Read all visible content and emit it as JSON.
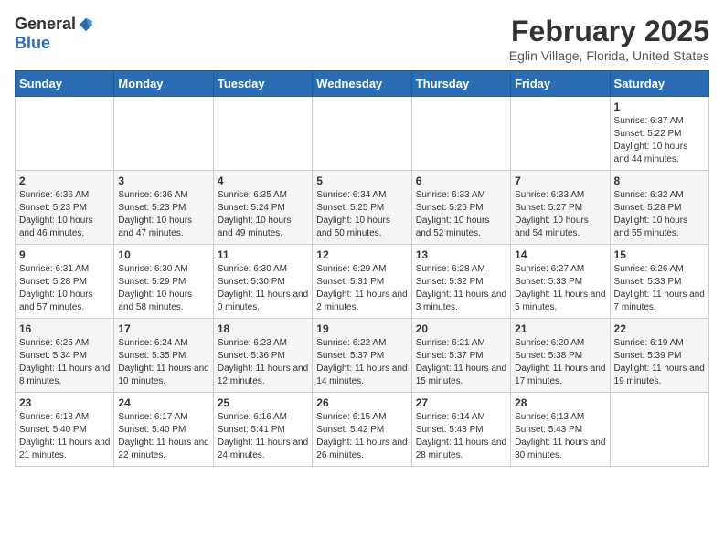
{
  "header": {
    "logo_general": "General",
    "logo_blue": "Blue",
    "month": "February 2025",
    "location": "Eglin Village, Florida, United States"
  },
  "days_of_week": [
    "Sunday",
    "Monday",
    "Tuesday",
    "Wednesday",
    "Thursday",
    "Friday",
    "Saturday"
  ],
  "weeks": [
    [
      {
        "day": "",
        "info": ""
      },
      {
        "day": "",
        "info": ""
      },
      {
        "day": "",
        "info": ""
      },
      {
        "day": "",
        "info": ""
      },
      {
        "day": "",
        "info": ""
      },
      {
        "day": "",
        "info": ""
      },
      {
        "day": "1",
        "info": "Sunrise: 6:37 AM\nSunset: 5:22 PM\nDaylight: 10 hours and 44 minutes."
      }
    ],
    [
      {
        "day": "2",
        "info": "Sunrise: 6:36 AM\nSunset: 5:23 PM\nDaylight: 10 hours and 46 minutes."
      },
      {
        "day": "3",
        "info": "Sunrise: 6:36 AM\nSunset: 5:23 PM\nDaylight: 10 hours and 47 minutes."
      },
      {
        "day": "4",
        "info": "Sunrise: 6:35 AM\nSunset: 5:24 PM\nDaylight: 10 hours and 49 minutes."
      },
      {
        "day": "5",
        "info": "Sunrise: 6:34 AM\nSunset: 5:25 PM\nDaylight: 10 hours and 50 minutes."
      },
      {
        "day": "6",
        "info": "Sunrise: 6:33 AM\nSunset: 5:26 PM\nDaylight: 10 hours and 52 minutes."
      },
      {
        "day": "7",
        "info": "Sunrise: 6:33 AM\nSunset: 5:27 PM\nDaylight: 10 hours and 54 minutes."
      },
      {
        "day": "8",
        "info": "Sunrise: 6:32 AM\nSunset: 5:28 PM\nDaylight: 10 hours and 55 minutes."
      }
    ],
    [
      {
        "day": "9",
        "info": "Sunrise: 6:31 AM\nSunset: 5:28 PM\nDaylight: 10 hours and 57 minutes."
      },
      {
        "day": "10",
        "info": "Sunrise: 6:30 AM\nSunset: 5:29 PM\nDaylight: 10 hours and 58 minutes."
      },
      {
        "day": "11",
        "info": "Sunrise: 6:30 AM\nSunset: 5:30 PM\nDaylight: 11 hours and 0 minutes."
      },
      {
        "day": "12",
        "info": "Sunrise: 6:29 AM\nSunset: 5:31 PM\nDaylight: 11 hours and 2 minutes."
      },
      {
        "day": "13",
        "info": "Sunrise: 6:28 AM\nSunset: 5:32 PM\nDaylight: 11 hours and 3 minutes."
      },
      {
        "day": "14",
        "info": "Sunrise: 6:27 AM\nSunset: 5:33 PM\nDaylight: 11 hours and 5 minutes."
      },
      {
        "day": "15",
        "info": "Sunrise: 6:26 AM\nSunset: 5:33 PM\nDaylight: 11 hours and 7 minutes."
      }
    ],
    [
      {
        "day": "16",
        "info": "Sunrise: 6:25 AM\nSunset: 5:34 PM\nDaylight: 11 hours and 8 minutes."
      },
      {
        "day": "17",
        "info": "Sunrise: 6:24 AM\nSunset: 5:35 PM\nDaylight: 11 hours and 10 minutes."
      },
      {
        "day": "18",
        "info": "Sunrise: 6:23 AM\nSunset: 5:36 PM\nDaylight: 11 hours and 12 minutes."
      },
      {
        "day": "19",
        "info": "Sunrise: 6:22 AM\nSunset: 5:37 PM\nDaylight: 11 hours and 14 minutes."
      },
      {
        "day": "20",
        "info": "Sunrise: 6:21 AM\nSunset: 5:37 PM\nDaylight: 11 hours and 15 minutes."
      },
      {
        "day": "21",
        "info": "Sunrise: 6:20 AM\nSunset: 5:38 PM\nDaylight: 11 hours and 17 minutes."
      },
      {
        "day": "22",
        "info": "Sunrise: 6:19 AM\nSunset: 5:39 PM\nDaylight: 11 hours and 19 minutes."
      }
    ],
    [
      {
        "day": "23",
        "info": "Sunrise: 6:18 AM\nSunset: 5:40 PM\nDaylight: 11 hours and 21 minutes."
      },
      {
        "day": "24",
        "info": "Sunrise: 6:17 AM\nSunset: 5:40 PM\nDaylight: 11 hours and 22 minutes."
      },
      {
        "day": "25",
        "info": "Sunrise: 6:16 AM\nSunset: 5:41 PM\nDaylight: 11 hours and 24 minutes."
      },
      {
        "day": "26",
        "info": "Sunrise: 6:15 AM\nSunset: 5:42 PM\nDaylight: 11 hours and 26 minutes."
      },
      {
        "day": "27",
        "info": "Sunrise: 6:14 AM\nSunset: 5:43 PM\nDaylight: 11 hours and 28 minutes."
      },
      {
        "day": "28",
        "info": "Sunrise: 6:13 AM\nSunset: 5:43 PM\nDaylight: 11 hours and 30 minutes."
      },
      {
        "day": "",
        "info": ""
      }
    ]
  ]
}
